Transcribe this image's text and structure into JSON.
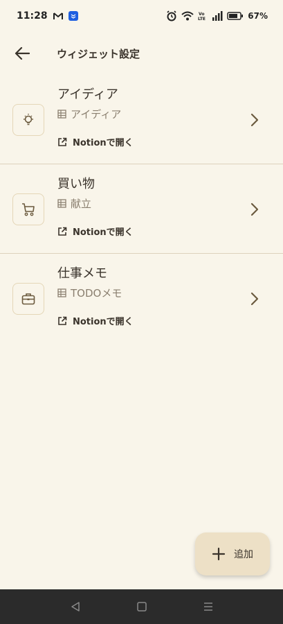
{
  "status_bar": {
    "time": "11:28",
    "battery": "67%"
  },
  "app_bar": {
    "title": "ウィジェット設定"
  },
  "widgets": [
    {
      "title": "アイディア",
      "database": "アイディア",
      "open_label": "Notionで開く",
      "icon": "lightbulb-icon"
    },
    {
      "title": "買い物",
      "database": "献立",
      "open_label": "Notionで開く",
      "icon": "cart-icon"
    },
    {
      "title": "仕事メモ",
      "database": "TODOメモ",
      "open_label": "Notionで開く",
      "icon": "briefcase-icon"
    }
  ],
  "fab": {
    "label": "追加"
  },
  "colors": {
    "background": "#f9f5ea",
    "fab": "#ede0c6",
    "divider": "#ddd1bc",
    "navbar": "#2b2b2b"
  }
}
